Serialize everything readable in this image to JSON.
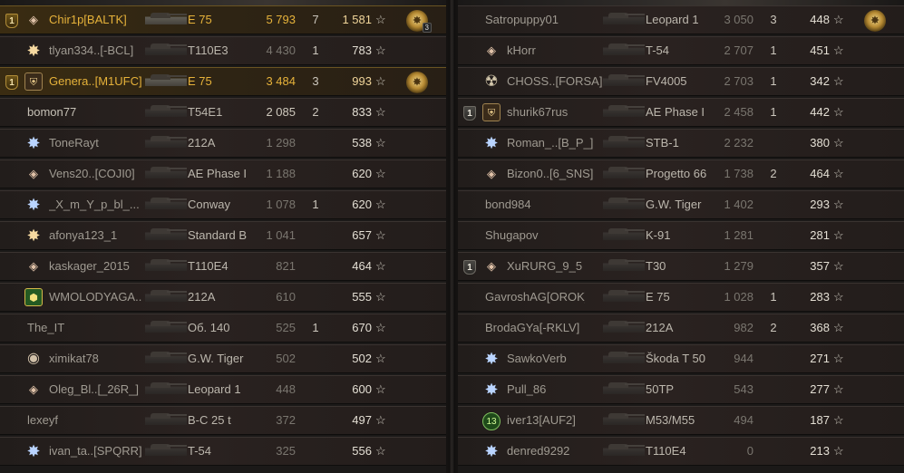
{
  "teams": {
    "left": [
      {
        "squad": "1",
        "squad_style": "gold",
        "clan": "diamond",
        "name": "Chir1p[BALTK]",
        "vehicle": "E 75",
        "damage": "5 793",
        "kills": "7",
        "xp": "1 581",
        "medal": true,
        "medal_count": "3",
        "highlight": true
      },
      {
        "squad": "",
        "clan": "star",
        "name": "tlyan334..[-BCL]",
        "vehicle": "T110E3",
        "damage": "4 430",
        "kills": "1",
        "xp": "783",
        "medal": false,
        "highlight": false
      },
      {
        "squad": "1",
        "squad_style": "gold",
        "clan": "shield",
        "name": "Genera..[M1UFC]",
        "vehicle": "E 75",
        "damage": "3 484",
        "kills": "3",
        "xp": "993",
        "medal": true,
        "medal_count": "",
        "highlight": true
      },
      {
        "squad": "",
        "clan": "",
        "name": "bomon77",
        "vehicle": "T54E1",
        "damage": "2 085",
        "kills": "2",
        "xp": "833",
        "medal": false,
        "highlight": false,
        "bright": true
      },
      {
        "squad": "",
        "clan": "starblue",
        "name": "ToneRayt",
        "vehicle": "212A",
        "damage": "1 298",
        "kills": "",
        "xp": "538",
        "medal": false,
        "highlight": false
      },
      {
        "squad": "",
        "clan": "diamond",
        "name": "Vens20..[COJI0]",
        "vehicle": "AE Phase I",
        "damage": "1 188",
        "kills": "",
        "xp": "620",
        "medal": false,
        "highlight": false
      },
      {
        "squad": "",
        "clan": "starblue",
        "name": "_X_m_Y_p_bl_...",
        "vehicle": "Conway",
        "damage": "1 078",
        "kills": "1",
        "xp": "620",
        "medal": false,
        "highlight": false
      },
      {
        "squad": "",
        "clan": "star",
        "name": "afonya123_1",
        "vehicle": "Standard B",
        "damage": "1 041",
        "kills": "",
        "xp": "657",
        "medal": false,
        "highlight": false
      },
      {
        "squad": "",
        "clan": "diamond",
        "name": "kaskager_2015",
        "vehicle": "T110E4",
        "damage": "821",
        "kills": "",
        "xp": "464",
        "medal": false,
        "highlight": false
      },
      {
        "squad": "",
        "clan": "hex",
        "name": "WMOLODYAGA..",
        "vehicle": "212A",
        "damage": "610",
        "kills": "",
        "xp": "555",
        "medal": false,
        "highlight": false
      },
      {
        "squad": "",
        "clan": "",
        "name": "The_IT",
        "vehicle": "Об. 140",
        "damage": "525",
        "kills": "1",
        "xp": "670",
        "medal": false,
        "highlight": false
      },
      {
        "squad": "",
        "clan": "round",
        "name": "ximikat78",
        "vehicle": "G.W. Tiger",
        "damage": "502",
        "kills": "",
        "xp": "502",
        "medal": false,
        "highlight": false
      },
      {
        "squad": "",
        "clan": "diamond",
        "name": "Oleg_Bl..[_26R_]",
        "vehicle": "Leopard 1",
        "damage": "448",
        "kills": "",
        "xp": "600",
        "medal": false,
        "highlight": false
      },
      {
        "squad": "",
        "clan": "",
        "name": "lexeyf",
        "vehicle": "B-C 25 t",
        "damage": "372",
        "kills": "",
        "xp": "497",
        "medal": false,
        "highlight": false
      },
      {
        "squad": "",
        "clan": "starblue",
        "name": "ivan_ta..[SPQRR]",
        "vehicle": "T-54",
        "damage": "325",
        "kills": "",
        "xp": "556",
        "medal": false,
        "highlight": false
      }
    ],
    "right": [
      {
        "squad": "",
        "clan": "",
        "name": "Satropuppy01",
        "vehicle": "Leopard 1",
        "damage": "3 050",
        "kills": "3",
        "xp": "448",
        "medal": true,
        "medal_count": "",
        "highlight": false
      },
      {
        "squad": "",
        "clan": "diamond",
        "name": "kHorr",
        "vehicle": "T-54",
        "damage": "2 707",
        "kills": "1",
        "xp": "451",
        "medal": false,
        "highlight": false
      },
      {
        "squad": "",
        "clan": "face",
        "name": "CHOSS..[FORSA]",
        "vehicle": "FV4005",
        "damage": "2 703",
        "kills": "1",
        "xp": "342",
        "medal": false,
        "highlight": false
      },
      {
        "squad": "1",
        "squad_style": "grey",
        "clan": "shield",
        "name": "shurik67rus",
        "vehicle": "AE Phase I",
        "damage": "2 458",
        "kills": "1",
        "xp": "442",
        "medal": false,
        "highlight": false
      },
      {
        "squad": "",
        "clan": "starblue",
        "name": "Roman_..[B_P_]",
        "vehicle": "STB-1",
        "damage": "2 232",
        "kills": "",
        "xp": "380",
        "medal": false,
        "highlight": false
      },
      {
        "squad": "",
        "clan": "diamond",
        "name": "Bizon0..[6_SNS]",
        "vehicle": "Progetto 66",
        "damage": "1 738",
        "kills": "2",
        "xp": "464",
        "medal": false,
        "highlight": false
      },
      {
        "squad": "",
        "clan": "",
        "name": "bond984",
        "vehicle": "G.W. Tiger",
        "damage": "1 402",
        "kills": "",
        "xp": "293",
        "medal": false,
        "highlight": false
      },
      {
        "squad": "",
        "clan": "",
        "name": "Shugapov",
        "vehicle": "K-91",
        "damage": "1 281",
        "kills": "",
        "xp": "281",
        "medal": false,
        "highlight": false
      },
      {
        "squad": "1",
        "squad_style": "grey",
        "clan": "diamond",
        "name": "XuRURG_9_5",
        "vehicle": "T30",
        "damage": "1 279",
        "kills": "",
        "xp": "357",
        "medal": false,
        "highlight": false
      },
      {
        "squad": "",
        "clan": "",
        "name": "GavroshAG[OROK]",
        "vehicle": "E 75",
        "damage": "1 028",
        "kills": "1",
        "xp": "283",
        "medal": false,
        "highlight": false
      },
      {
        "squad": "",
        "clan": "",
        "name": "BrodaGYa[-RKLV]",
        "vehicle": "212A",
        "damage": "982",
        "kills": "2",
        "xp": "368",
        "medal": false,
        "highlight": false
      },
      {
        "squad": "",
        "clan": "starblue",
        "name": "SawkoVerb",
        "vehicle": "Škoda T 50",
        "damage": "944",
        "kills": "",
        "xp": "271",
        "medal": false,
        "highlight": false
      },
      {
        "squad": "",
        "clan": "starblue",
        "name": "Pull_86",
        "vehicle": "50TP",
        "damage": "543",
        "kills": "",
        "xp": "277",
        "medal": false,
        "highlight": false
      },
      {
        "squad": "",
        "clan": "num",
        "name": "iver13[AUF2]",
        "vehicle": "M53/M55",
        "damage": "494",
        "kills": "",
        "xp": "187",
        "medal": false,
        "highlight": false
      },
      {
        "squad": "",
        "clan": "starblue",
        "name": "denred9292",
        "vehicle": "T110E4",
        "damage": "0",
        "kills": "",
        "xp": "213",
        "medal": false,
        "highlight": false
      }
    ]
  },
  "star_glyph": "☆"
}
